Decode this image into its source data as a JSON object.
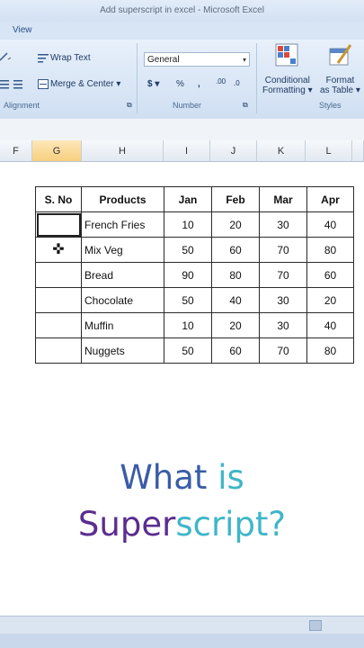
{
  "window": {
    "title": "Add superscript in excel - Microsoft Excel"
  },
  "ribbon": {
    "tab_view": "View",
    "wrap_text": "Wrap Text",
    "merge_center": "Merge & Center",
    "number_format": "General",
    "currency": "$",
    "percent": "%",
    "comma": ",",
    "inc_decimal": ".00",
    "dec_decimal": ".0",
    "conditional_formatting_1": "Conditional",
    "conditional_formatting_2": "Formatting",
    "format_table_1": "Format",
    "format_table_2": "as Table",
    "group_alignment": "Alignment",
    "group_number": "Number",
    "group_styles": "Styles"
  },
  "columns": [
    "F",
    "G",
    "H",
    "I",
    "J",
    "K",
    "L"
  ],
  "active_column": "G",
  "table": {
    "headers": [
      "S. No",
      "Products",
      "Jan",
      "Feb",
      "Mar",
      "Apr"
    ],
    "rows": [
      [
        "",
        "French Fries",
        "10",
        "20",
        "30",
        "40"
      ],
      [
        "",
        "Mix Veg",
        "50",
        "60",
        "70",
        "80"
      ],
      [
        "",
        "Bread",
        "90",
        "80",
        "70",
        "60"
      ],
      [
        "",
        "Chocolate",
        "50",
        "40",
        "30",
        "20"
      ],
      [
        "",
        "Muffin",
        "10",
        "20",
        "30",
        "40"
      ],
      [
        "",
        "Nuggets",
        "50",
        "60",
        "70",
        "80"
      ]
    ]
  },
  "overlay": {
    "line1_a": "What",
    "line1_b": "is",
    "line2_a": "Super",
    "line2_b": "script?",
    "color_purple": "#5b2d8f",
    "color_blue": "#3a5ca8",
    "color_teal": "#3fb6c8"
  }
}
